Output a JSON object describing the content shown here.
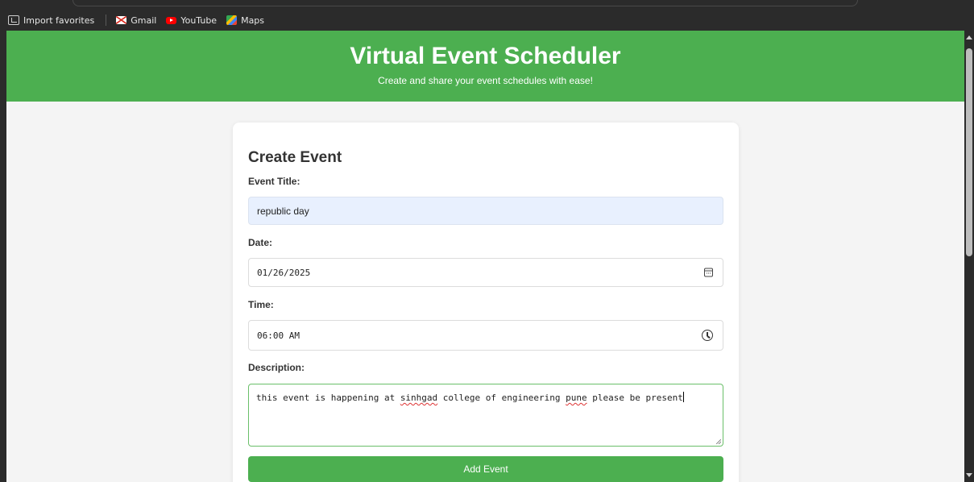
{
  "browser": {
    "bookmarks": [
      {
        "label": "Import favorites",
        "icon": "import-icon"
      },
      {
        "label": "Gmail",
        "icon": "gmail-icon"
      },
      {
        "label": "YouTube",
        "icon": "youtube-icon"
      },
      {
        "label": "Maps",
        "icon": "maps-icon"
      }
    ]
  },
  "header": {
    "title": "Virtual Event Scheduler",
    "subtitle": "Create and share your event schedules with ease!"
  },
  "form": {
    "heading": "Create Event",
    "title_label": "Event Title:",
    "title_value": "republic day",
    "date_label": "Date:",
    "date_value": "01/26/2025",
    "time_label": "Time:",
    "time_value": "06:00 AM",
    "description_label": "Description:",
    "description_parts": [
      "this event is happening at ",
      "sinhgad",
      " college of engineering ",
      "pune",
      " please be present"
    ],
    "submit_label": "Add Event"
  },
  "colors": {
    "accent": "#4caf50",
    "autofill_bg": "#e8f0fe",
    "page_bg": "#f4f4f4"
  }
}
